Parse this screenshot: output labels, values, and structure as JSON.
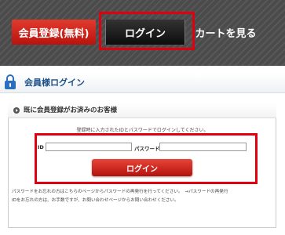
{
  "nav": {
    "register_label": "会員登録(無料)",
    "login_label": "ログイン",
    "cart_label": "カートを見る"
  },
  "section": {
    "title": "会員様ログイン",
    "icon": "lock-icon"
  },
  "login_panel": {
    "heading": "既に会員登録がお済みのお客様",
    "instruction": "登録時に入力されたIDとパスワードでログインしてください。",
    "id_label": "ID",
    "id_value": "",
    "password_label": "パスワード",
    "password_value": "",
    "submit_label": "ログイン"
  },
  "footnote": {
    "line1": "パスワードをお忘れの方はこちらのページからパスワードの再発行を行ってください。　→パスワードの再発行",
    "line2": "IDをお忘れの方は、お手数ですが、お問い合わせページからお問い合わせください。"
  },
  "colors": {
    "highlight": "#e0000e",
    "accent_red": "#c8201a",
    "section_title": "#1b4f88"
  }
}
